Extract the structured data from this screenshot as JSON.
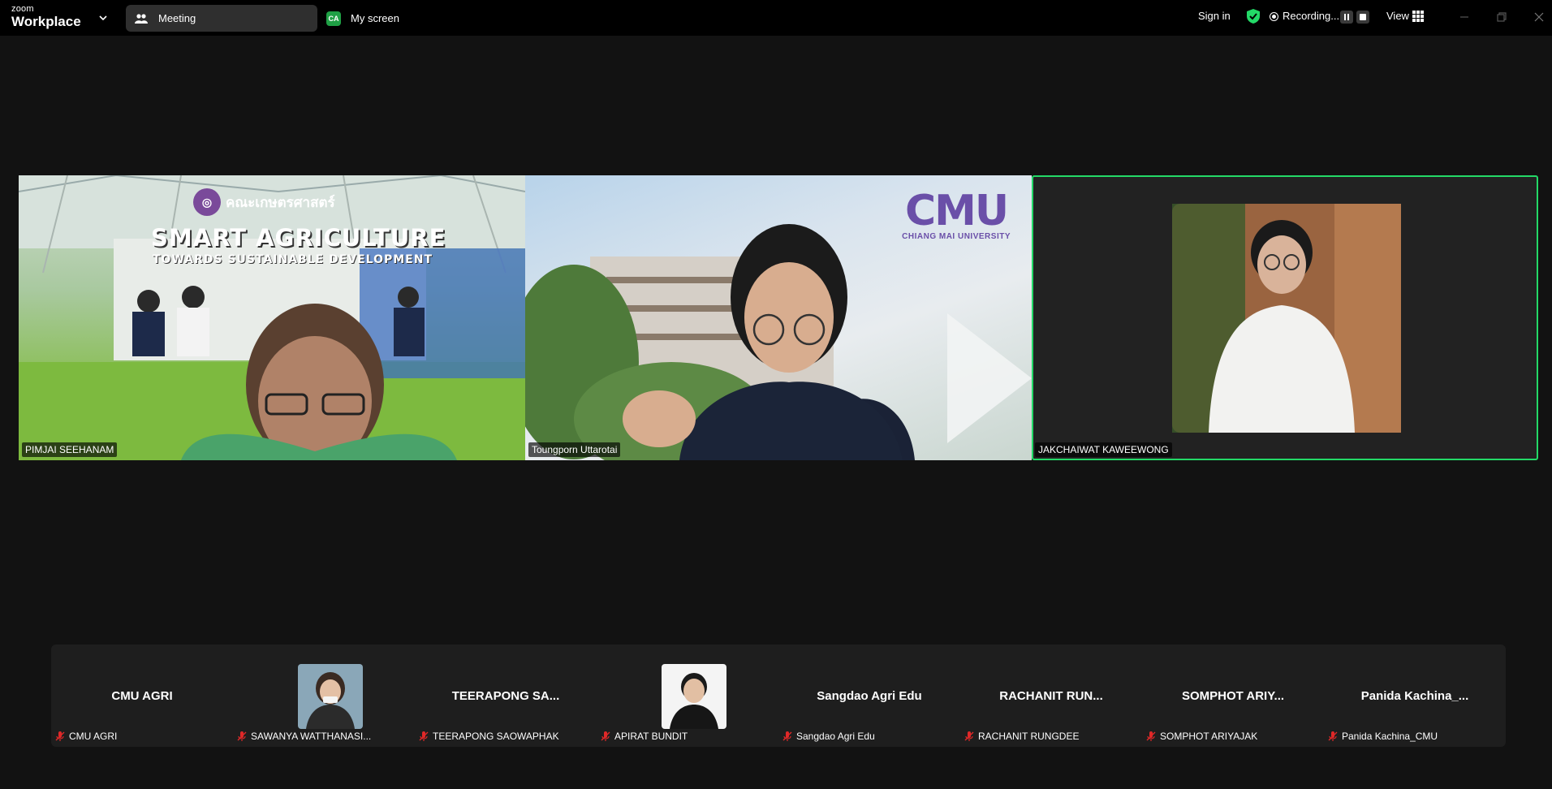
{
  "app": {
    "brand_small": "zoom",
    "brand_big": "Workplace"
  },
  "tabs": {
    "meeting": "Meeting",
    "my_screen_badge": "CA",
    "my_screen": "My screen"
  },
  "toolbar": {
    "sign_in": "Sign in",
    "recording": "Recording...",
    "view": "View"
  },
  "colors": {
    "active_speaker": "#23d967",
    "shield": "#23d967",
    "muted": "#e02828",
    "cmu_purple": "#6a4fa8"
  },
  "videos": [
    {
      "name": "PIMJAI SEEHANAM",
      "banner_title": "SMART AGRICULTURE",
      "banner_subtitle": "TOWARDS SUSTAINABLE DEVELOPMENT",
      "faculty_logo": "คณะเกษตรศาสตร์"
    },
    {
      "name": "Toungporn Uttarotai",
      "logo_big": "CMU",
      "logo_small": "CHIANG MAI UNIVERSITY"
    },
    {
      "name": "JAKCHAIWAT KAWEEWONG",
      "active_speaker": true
    }
  ],
  "gallery": [
    {
      "display": "CMU AGRI",
      "label": "CMU AGRI",
      "has_photo": false
    },
    {
      "display": "",
      "label": "SAWANYA WATTHANASI...",
      "has_photo": true
    },
    {
      "display": "TEERAPONG SA...",
      "label": "TEERAPONG SAOWAPHAK",
      "has_photo": false
    },
    {
      "display": "",
      "label": "APIRAT BUNDIT",
      "has_photo": true
    },
    {
      "display": "Sangdao Agri Edu",
      "label": "Sangdao Agri Edu",
      "has_photo": false
    },
    {
      "display": "RACHANIT RUN...",
      "label": "RACHANIT RUNGDEE",
      "has_photo": false
    },
    {
      "display": "SOMPHOT ARIY...",
      "label": "SOMPHOT ARIYAJAK",
      "has_photo": false
    },
    {
      "display": "Panida  Kachina_...",
      "label": "Panida Kachina_CMU",
      "has_photo": false
    }
  ]
}
